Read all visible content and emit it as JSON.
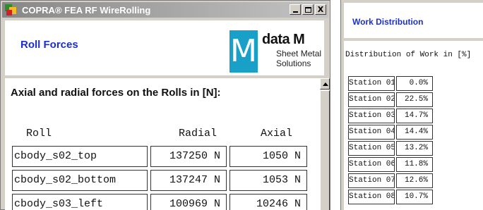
{
  "left_window": {
    "title": "COPRA® FEA RF WireRolling",
    "controls": {
      "minimize": "_",
      "maximize": "□",
      "close": "X"
    },
    "heading": "Roll Forces",
    "logo": {
      "brand": "data M",
      "line1": "Sheet Metal",
      "line2": "Solutions"
    },
    "forces_title": "Axial and radial forces on the Rolls in [N]:",
    "columns": {
      "roll": "Roll",
      "radial": "Radial",
      "axial": "Axial"
    },
    "rows": [
      {
        "roll": "cbody_s02_top",
        "radial": "137250 N",
        "axial": "1050 N"
      },
      {
        "roll": "cbody_s02_bottom",
        "radial": "137247 N",
        "axial": "1053 N"
      },
      {
        "roll": "cbody_s03_left",
        "radial": "100969 N",
        "axial": "10246 N"
      }
    ]
  },
  "right_window": {
    "heading": "Work Distribution",
    "title": "Distribution of Work in [%]",
    "rows": [
      {
        "station": "Station 01",
        "percent": "0.0%"
      },
      {
        "station": "Station 02",
        "percent": "22.5%"
      },
      {
        "station": "Station 03",
        "percent": "14.7%"
      },
      {
        "station": "Station 04",
        "percent": "14.4%"
      },
      {
        "station": "Station 05",
        "percent": "13.2%"
      },
      {
        "station": "Station 06",
        "percent": "11.8%"
      },
      {
        "station": "Station 07",
        "percent": "12.6%"
      },
      {
        "station": "Station 08",
        "percent": "10.7%"
      }
    ]
  },
  "colors": {
    "heading_blue": "#1a2fd0",
    "logo_cyan": "#18a0c8",
    "window_gray": "#d4d0c8"
  }
}
